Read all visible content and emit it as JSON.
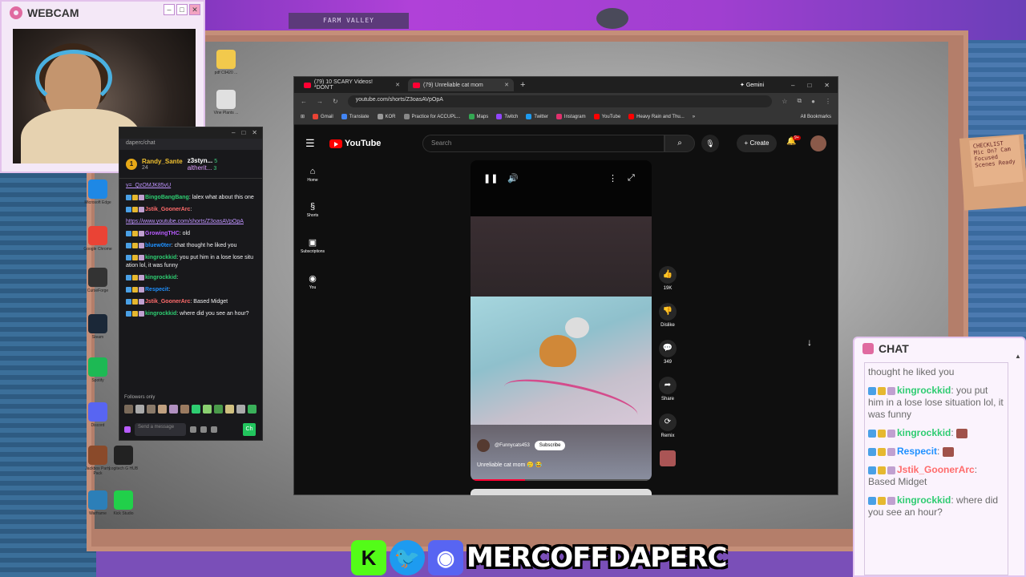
{
  "background": {
    "sign_text": "FARM VALLEY",
    "note_text": "CHECKLIST Mic On? Cam Focused Scenes Ready"
  },
  "webcam": {
    "title": "WEBCAM",
    "ctrl_min": "–",
    "ctrl_max": "□",
    "ctrl_close": "✕"
  },
  "desktop_icons": [
    {
      "label": "pdf C9420 ..."
    },
    {
      "label": "Vine Plants ..."
    },
    {
      "label": "Microsoft Edge"
    },
    {
      "label": "Google Chrome"
    },
    {
      "label": "CurseForge"
    },
    {
      "label": "Steam"
    },
    {
      "label": "Spotify"
    },
    {
      "label": "Discord"
    },
    {
      "label": "Jackbox Party Pack"
    },
    {
      "label": "Logitech G HUB"
    },
    {
      "label": "Warframe"
    },
    {
      "label": "Kick Studio"
    }
  ],
  "twitch_chat": {
    "ctrl_min": "–",
    "ctrl_max": "□",
    "ctrl_close": "✕",
    "url": "daperc/chat",
    "leader_rank": "1",
    "leader_name": "Randy_Sante",
    "leader_count": "24",
    "second_name": "z3styn...",
    "second_points": "5",
    "third_name": "altherit...",
    "third_points": "3",
    "messages": [
      {
        "user": "",
        "color": "#bf94ff",
        "text": "v=_QzOMJK85vU",
        "link": true
      },
      {
        "user": "BingoBangBang",
        "color": "#2ecc71",
        "text": ": lalex what about this one"
      },
      {
        "user": "Jstik_GoonerArc",
        "color": "#ff6b6b",
        "text": ":"
      },
      {
        "user": "",
        "color": "#bf94ff",
        "text": "https://www.youtube.com/shorts/Z3oasAVpOpA",
        "link": true
      },
      {
        "user": "GrowingTHC",
        "color": "#b85cff",
        "text": ": old"
      },
      {
        "user": "bluew0ter",
        "color": "#1e90ff",
        "text": ": chat thought he liked you"
      },
      {
        "user": "kingrockkid",
        "color": "#2ecc71",
        "text": ": you put him in a lose lose situation lol, it was funny"
      },
      {
        "user": "kingrockkid",
        "color": "#2ecc71",
        "text": ":"
      },
      {
        "user": "Respecit",
        "color": "#1e90ff",
        "text": ":"
      },
      {
        "user": "Jstik_GoonerArc",
        "color": "#ff6b6b",
        "text": ": Based Midget"
      },
      {
        "user": "kingrockkid",
        "color": "#2ecc71",
        "text": ": where did you see an hour?"
      }
    ],
    "followers_only": "Followers only",
    "input_placeholder": "Send a message",
    "chat_button": "Ch"
  },
  "browser": {
    "tabs": [
      {
        "label": "(79) 10 SCARY Videos! *DON'T",
        "close": "✕"
      },
      {
        "label": "(79) Unreliable cat mom",
        "close": "✕"
      }
    ],
    "new_tab": "+",
    "gemini": "✦ Gemini",
    "win_min": "–",
    "win_max": "□",
    "win_close": "✕",
    "url": "youtube.com/shorts/Z3oasAVpOpA",
    "bookmarks": [
      {
        "label": "Gmail",
        "color": "#ea4335"
      },
      {
        "label": "Translate",
        "color": "#4285f4"
      },
      {
        "label": "KOR",
        "color": "#999999"
      },
      {
        "label": "Practice for ACCUPL...",
        "color": "#888888"
      },
      {
        "label": "Maps",
        "color": "#34a853"
      },
      {
        "label": "Twitch",
        "color": "#9146ff"
      },
      {
        "label": "Twitter",
        "color": "#1d9bf0"
      },
      {
        "label": "Instagram",
        "color": "#e1306c"
      },
      {
        "label": "YouTube",
        "color": "#ff0000"
      },
      {
        "label": "Heavy Rain and Thu...",
        "color": "#ff0000"
      }
    ],
    "bookmarks_more": "»",
    "all_bookmarks": "All Bookmarks"
  },
  "youtube": {
    "logo": "YouTube",
    "search_placeholder": "Search",
    "create": "+ Create",
    "notif_count": "9+",
    "sidebar": [
      {
        "icon": "home-icon",
        "glyph": "⌂",
        "label": "Home"
      },
      {
        "icon": "shorts-icon",
        "glyph": "§",
        "label": "Shorts"
      },
      {
        "icon": "subscriptions-icon",
        "glyph": "▣",
        "label": "Subscriptions"
      },
      {
        "icon": "you-icon",
        "glyph": "◉",
        "label": "You"
      }
    ],
    "short": {
      "channel": "@Funnycats453",
      "subscribe": "Subscribe",
      "caption": "Unreliable cat mom 🥲 😂",
      "progress": 0.3
    },
    "actions": {
      "likes": "19K",
      "dislike": "Dislike",
      "comments": "349",
      "share": "Share",
      "remix": "Remix"
    }
  },
  "stream_chat": {
    "title": "CHAT",
    "messages": [
      {
        "user": "",
        "color": "#777777",
        "text": "thought he liked you"
      },
      {
        "user": "kingrockkid",
        "color": "#2ecc71",
        "text": ": you put him in a lose lose situation lol, it was funny"
      },
      {
        "user": "kingrockkid",
        "color": "#2ecc71",
        "text": ":",
        "emote": true
      },
      {
        "user": "Respecit",
        "color": "#1e90ff",
        "text": ":",
        "emote": true
      },
      {
        "user": "Jstik_GoonerArc",
        "color": "#ff6b6b",
        "text": ": Based Midget"
      },
      {
        "user": "kingrockkid",
        "color": "#2ecc71",
        "text": ": where did you see an hour?"
      }
    ]
  },
  "social_bar": {
    "kick": "K",
    "twitter": "🐦",
    "discord": "◉",
    "handle": "MERCOFFDAPERC"
  }
}
